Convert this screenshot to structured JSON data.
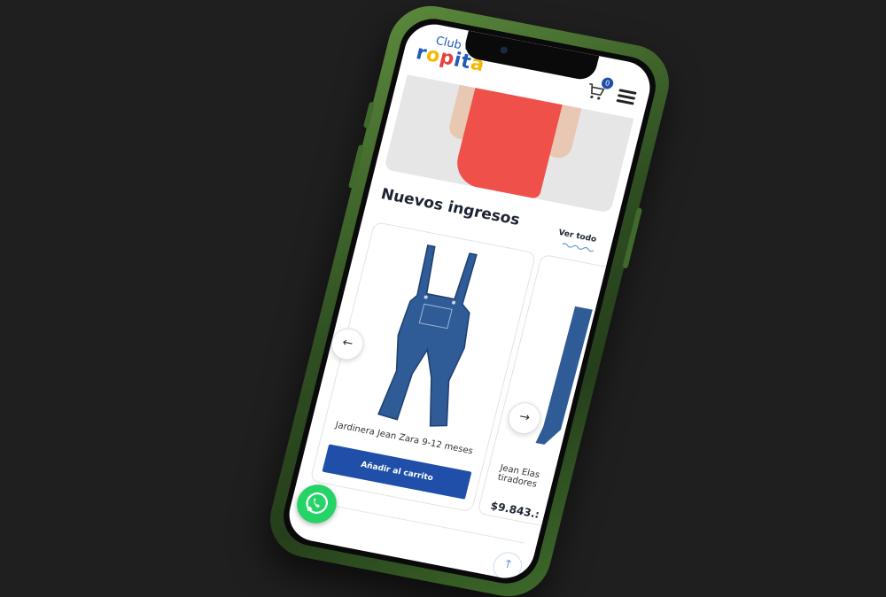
{
  "header": {
    "logo_top": "Club de",
    "logo_main": "ropita",
    "cart_count": "0"
  },
  "section": {
    "title": "Nuevos ingresos",
    "see_all": "Ver todo"
  },
  "products": [
    {
      "name": "Jardinera Jean Zara 9-12 meses",
      "button": "Añadir al carrito"
    },
    {
      "name": "Jean Elas tiradores",
      "price": "$9.843.:"
    }
  ],
  "nav": {
    "prev": "←",
    "next": "→"
  },
  "to_top": "↑",
  "colors": {
    "brand": "#1f4fa8",
    "whatsapp": "#25d366",
    "phone_frame": "#2f4f22",
    "hero_dress": "#f0504a"
  },
  "icons": {
    "cart": "cart-icon",
    "menu": "hamburger-menu-icon",
    "whatsapp": "whatsapp-icon",
    "back_to_top": "arrow-up-icon"
  }
}
